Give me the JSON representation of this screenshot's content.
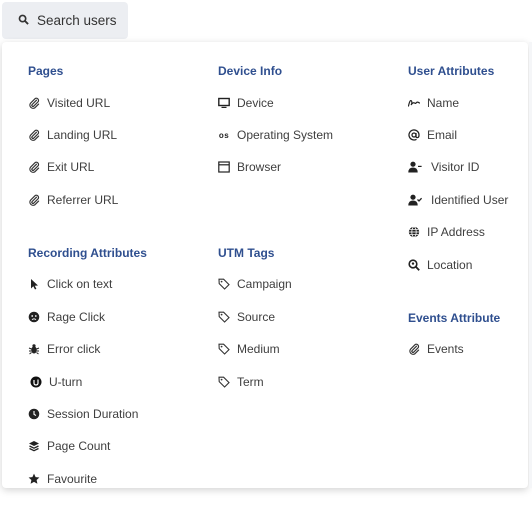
{
  "search": {
    "label": "Search users"
  },
  "columns": [
    {
      "sections": [
        {
          "title": "Pages",
          "items": [
            {
              "label": "Visited URL",
              "icon": "paperclip-icon"
            },
            {
              "label": "Landing URL",
              "icon": "paperclip-icon"
            },
            {
              "label": "Exit URL",
              "icon": "paperclip-icon"
            },
            {
              "label": "Referrer URL",
              "icon": "paperclip-icon"
            }
          ]
        },
        {
          "title": "Recording Attributes",
          "items": [
            {
              "label": "Click on text",
              "icon": "pointer-icon"
            },
            {
              "label": "Rage Click",
              "icon": "angry-face-icon"
            },
            {
              "label": "Error click",
              "icon": "bug-icon"
            },
            {
              "label": "U-turn",
              "icon": "u-turn-icon"
            },
            {
              "label": "Session Duration",
              "icon": "clock-icon"
            },
            {
              "label": "Page Count",
              "icon": "layers-icon"
            },
            {
              "label": "Favourite",
              "icon": "star-icon"
            }
          ]
        }
      ]
    },
    {
      "sections": [
        {
          "title": "Device Info",
          "items": [
            {
              "label": "Device",
              "icon": "monitor-icon"
            },
            {
              "label": "Operating System",
              "icon": "os-icon"
            },
            {
              "label": "Browser",
              "icon": "browser-window-icon"
            }
          ]
        },
        {
          "title": "UTM Tags",
          "items": [
            {
              "label": "Campaign",
              "icon": "tag-icon"
            },
            {
              "label": "Source",
              "icon": "tag-icon"
            },
            {
              "label": "Medium",
              "icon": "tag-icon"
            },
            {
              "label": "Term",
              "icon": "tag-icon"
            }
          ]
        }
      ]
    },
    {
      "sections": [
        {
          "title": "User Attributes",
          "items": [
            {
              "label": "Name",
              "icon": "signature-icon"
            },
            {
              "label": "Email",
              "icon": "at-sign-icon"
            },
            {
              "label": "Visitor ID",
              "icon": "user-icon"
            },
            {
              "label": "Identified User",
              "icon": "user-check-icon"
            },
            {
              "label": "IP Address",
              "icon": "globe-icon"
            },
            {
              "label": "Location",
              "icon": "search-location-icon"
            }
          ]
        },
        {
          "title": "Events Attribute",
          "items": [
            {
              "label": "Events",
              "icon": "paperclip-icon"
            }
          ]
        }
      ]
    }
  ]
}
